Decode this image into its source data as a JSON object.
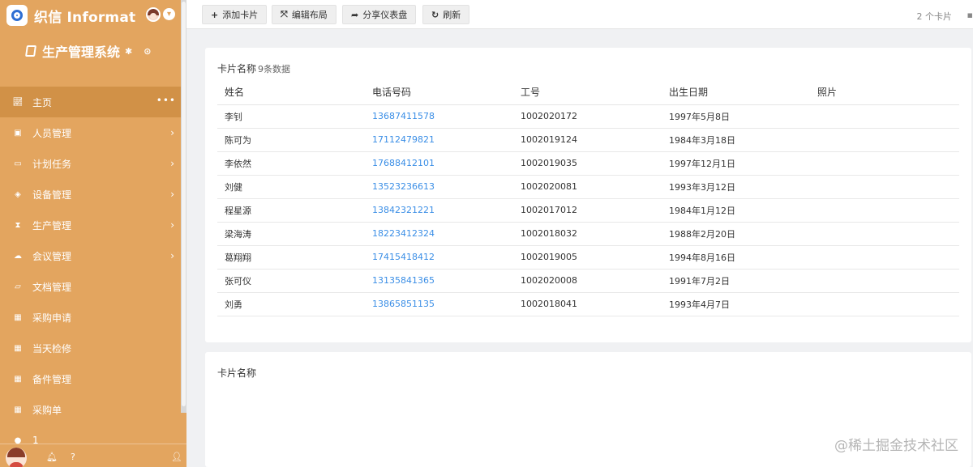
{
  "app": {
    "brand": "织信 Informat",
    "system_title": "生产管理系统"
  },
  "sidebar": {
    "items": [
      {
        "label": "主页",
        "icon": "line-chart-icon",
        "active": true,
        "has_more": true
      },
      {
        "label": "人员管理",
        "icon": "user-icon",
        "has_arrow": true
      },
      {
        "label": "计划任务",
        "icon": "calendar-icon",
        "has_arrow": true
      },
      {
        "label": "设备管理",
        "icon": "cube-icon",
        "has_arrow": true
      },
      {
        "label": "生产管理",
        "icon": "hourglass-icon",
        "has_arrow": true
      },
      {
        "label": "会议管理",
        "icon": "cloud-icon",
        "has_arrow": true
      },
      {
        "label": "文档管理",
        "icon": "folder-open-icon"
      },
      {
        "label": "采购申请",
        "icon": "table-icon"
      },
      {
        "label": "当天检修",
        "icon": "table-icon"
      },
      {
        "label": "备件管理",
        "icon": "table-icon"
      },
      {
        "label": "采购单",
        "icon": "table-icon"
      },
      {
        "label": "1",
        "icon": "globe-icon"
      }
    ],
    "more_glyph": "•••",
    "arrow_glyph": "›"
  },
  "toolbar": {
    "add_card": "添加卡片",
    "edit_layout": "编辑布局",
    "share_dashboard": "分享仪表盘",
    "refresh": "刷新",
    "card_count": "2 个卡片"
  },
  "card1": {
    "title": "卡片名称",
    "count": "9条数据",
    "columns": [
      "姓名",
      "电话号码",
      "工号",
      "出生日期",
      "照片"
    ],
    "rows": [
      {
        "name": "李钊",
        "phone": "13687411578",
        "id": "1002020172",
        "dob": "1997年5月8日",
        "photo": ""
      },
      {
        "name": "陈可为",
        "phone": "17112479821",
        "id": "1002019124",
        "dob": "1984年3月18日",
        "photo": ""
      },
      {
        "name": "李依然",
        "phone": "17688412101",
        "id": "1002019035",
        "dob": "1997年12月1日",
        "photo": ""
      },
      {
        "name": "刘健",
        "phone": "13523236613",
        "id": "1002020081",
        "dob": "1993年3月12日",
        "photo": ""
      },
      {
        "name": "程星源",
        "phone": "13842321221",
        "id": "1002017012",
        "dob": "1984年1月12日",
        "photo": ""
      },
      {
        "name": "梁海涛",
        "phone": "18223412324",
        "id": "1002018032",
        "dob": "1988年2月20日",
        "photo": ""
      },
      {
        "name": "葛翔翔",
        "phone": "17415418412",
        "id": "1002019005",
        "dob": "1994年8月16日",
        "photo": ""
      },
      {
        "name": "张可仪",
        "phone": "13135841365",
        "id": "1002020008",
        "dob": "1991年7月2日",
        "photo": ""
      },
      {
        "name": "刘勇",
        "phone": "13865851135",
        "id": "1002018041",
        "dob": "1993年4月7日",
        "photo": ""
      }
    ]
  },
  "card2": {
    "title": "卡片名称"
  },
  "watermark": "@稀土掘金技术社区",
  "colors": {
    "sidebar_bg": "#e3a55f",
    "sidebar_active": "#d19147",
    "link": "#3a8ee6"
  }
}
